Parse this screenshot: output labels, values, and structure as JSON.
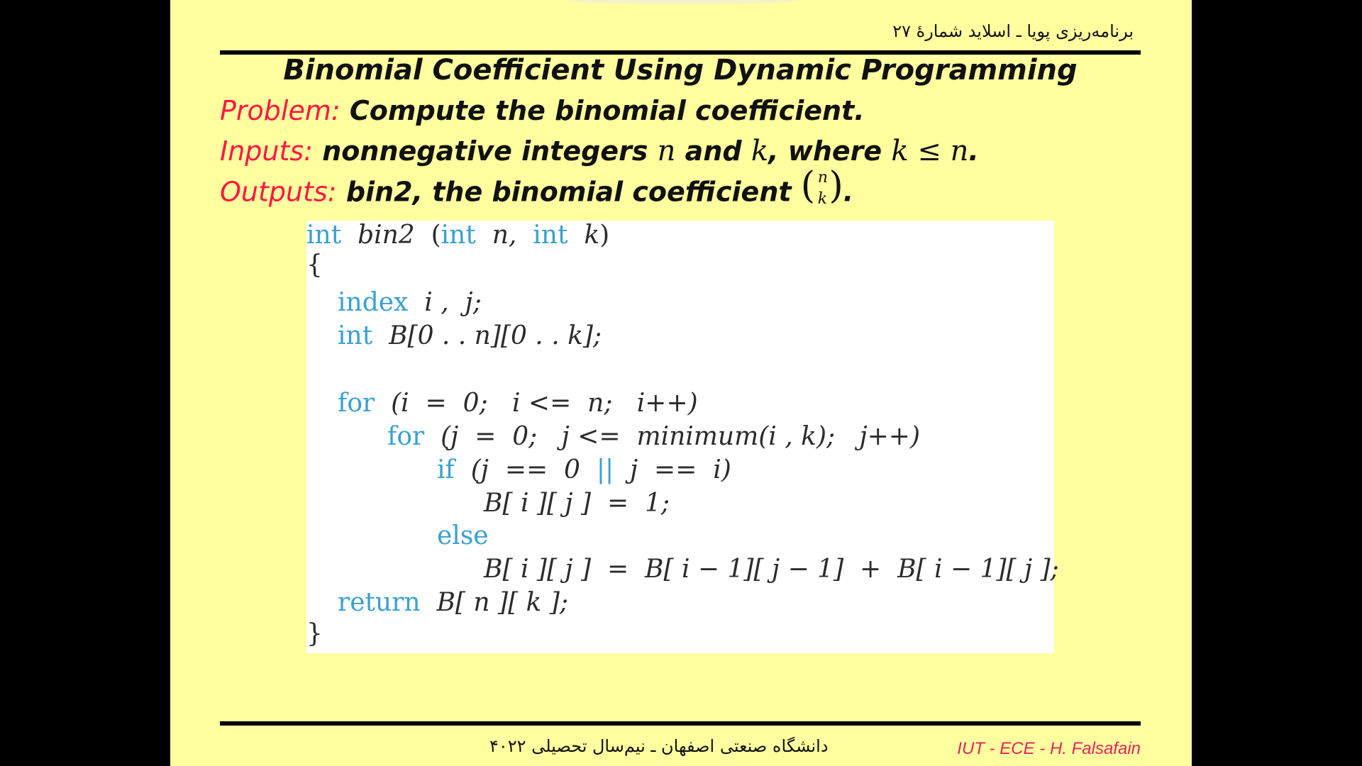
{
  "header": {
    "right_text": "برنامه‌ریزی پویا ـ اسلاید شمارهٔ ۲۷"
  },
  "title": "Binomial Coefficient Using Dynamic Programming",
  "problem": {
    "label": "Problem:",
    "text": "Compute the binomial coefficient."
  },
  "inputs": {
    "label": "Inputs:",
    "t1": "nonnegative integers",
    "n": "n",
    "t2": "and",
    "k": "k",
    "t3": ", where",
    "cond": "k ≤ n",
    "t4": "."
  },
  "outputs": {
    "label": "Outputs:",
    "text": "bin2, the binomial coefficient",
    "binom_top": "n",
    "binom_bottom": "k",
    "end": "."
  },
  "code": {
    "sig_kw": "int",
    "sig_name": "bin2",
    "sig_open": "(",
    "sig_int1": "int",
    "sig_n": "n,",
    "sig_int2": "int",
    "sig_k": "k",
    "sig_close": ")",
    "open_brace": "{",
    "decl1_kw": "index",
    "decl1_rest": "i ,  j;",
    "decl2_kw": "int",
    "decl2_rest": "B[0 . . n][0 . . k];",
    "for1_kw": "for",
    "for1_rest": "(i  =  0;   i <=  n;   i++)",
    "for2_kw": "for",
    "for2_rest": "(j  =  0;   j <=  minimum(i , k);   j++)",
    "if_kw": "if",
    "if_a": "(j  ==  0",
    "if_or": "||",
    "if_b": "j  ==  i)",
    "assign1": "B[ i ][ j ]  =  1;",
    "else_kw": "else",
    "assign2": "B[ i ][ j ]  =  B[ i − 1][ j − 1]  +  B[ i − 1][ j ];",
    "return_kw": "return",
    "return_rest": "B[ n ][ k ];",
    "close_brace": "}"
  },
  "footer": {
    "center_text": "دانشگاه صنعتی اصفهان ـ نیم‌سال تحصیلی ۴۰۲۲",
    "credit": "IUT - ECE - H. Falsafain"
  },
  "colors": {
    "slide_bg": "#ffff9f",
    "label_red": "#ff1744",
    "keyword_blue": "#3aa0d0",
    "credit_pink": "#e0245e"
  }
}
